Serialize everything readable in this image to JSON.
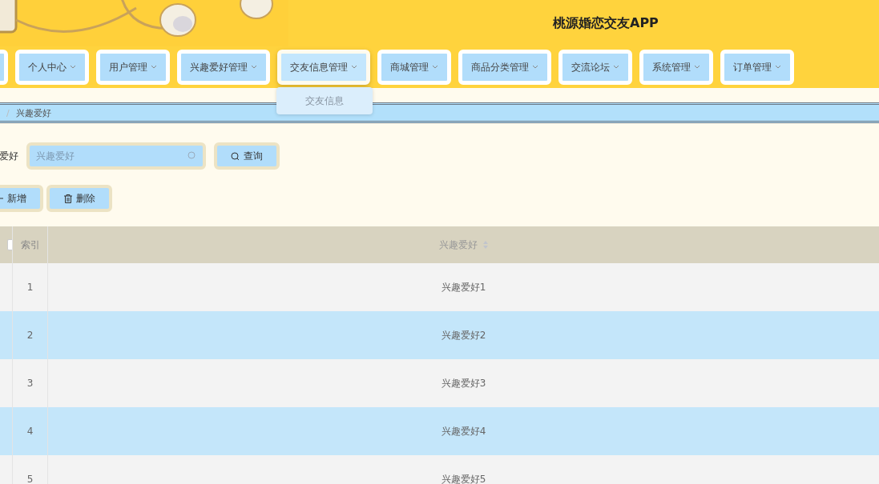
{
  "header": {
    "title": "桃源婚恋交友APP"
  },
  "nav": [
    {
      "selected": false
    },
    {
      "label": "个人中心",
      "selected": false
    },
    {
      "label": "用户管理",
      "selected": false
    },
    {
      "label": "兴趣爱好管理",
      "selected": false
    },
    {
      "label": "交友信息管理",
      "selected": true,
      "menu": [
        "交友信息"
      ]
    },
    {
      "label": "商城管理",
      "selected": false
    },
    {
      "label": "商品分类管理",
      "selected": false
    },
    {
      "label": "交流论坛",
      "selected": false
    },
    {
      "label": "系统管理",
      "selected": false
    },
    {
      "label": "订单管理",
      "selected": false
    }
  ],
  "breadcrumb": {
    "separator": "/",
    "current": "兴趣爱好"
  },
  "search": {
    "label": "爱好",
    "placeholder": "兴趣爱好",
    "button": "查询"
  },
  "actions": [
    {
      "kind": "add",
      "label": "新增"
    },
    {
      "kind": "delete",
      "label": "删除"
    }
  ],
  "table": {
    "select_all": {
      "checked": false
    },
    "columns": [
      "索引",
      "兴趣爱好"
    ],
    "rows": [
      {
        "index": "1",
        "value": "兴趣爱好1",
        "highlighted": false
      },
      {
        "index": "2",
        "value": "兴趣爱好2",
        "highlighted": true
      },
      {
        "index": "3",
        "value": "兴趣爱好3",
        "highlighted": false
      },
      {
        "index": "4",
        "value": "兴趣爱好4",
        "highlighted": true
      },
      {
        "index": "5",
        "value": "兴趣爱好5",
        "highlighted": false
      }
    ]
  }
}
